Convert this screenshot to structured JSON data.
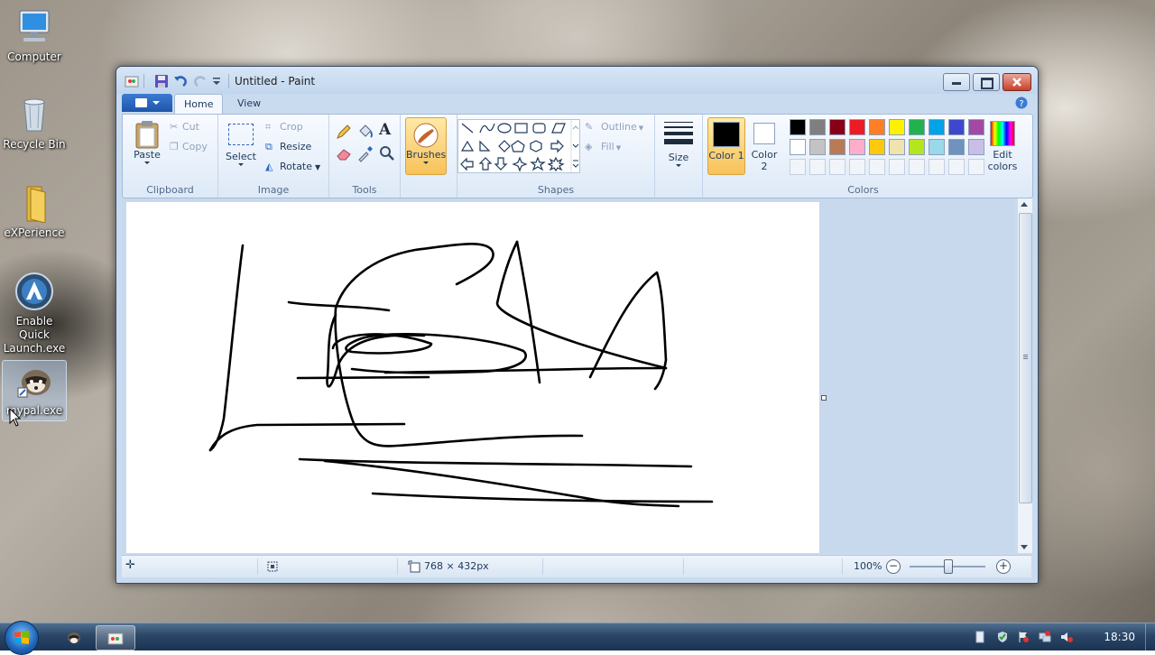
{
  "desktop": {
    "icons": [
      {
        "label": "Computer",
        "icon": "computer-icon"
      },
      {
        "label": "Recycle Bin",
        "icon": "recycle-bin-icon"
      },
      {
        "label": "eXPerience",
        "icon": "folder-icon"
      },
      {
        "label": "Enable Quick Launch.exe",
        "icon": "app-icon"
      },
      {
        "label": "mypal.exe",
        "icon": "raccoon-icon"
      }
    ]
  },
  "window": {
    "title": "Untitled - Paint",
    "tabs": [
      "Home",
      "View"
    ],
    "active_tab": "Home"
  },
  "ribbon": {
    "clipboard": {
      "label": "Clipboard",
      "paste": "Paste",
      "cut": "Cut",
      "copy": "Copy"
    },
    "image": {
      "label": "Image",
      "select": "Select",
      "crop": "Crop",
      "resize": "Resize",
      "rotate": "Rotate"
    },
    "tools": {
      "label": "Tools"
    },
    "brushes": {
      "label": "Brushes"
    },
    "shapes": {
      "label": "Shapes",
      "outline": "Outline",
      "fill": "Fill"
    },
    "size": {
      "label": "Size"
    },
    "colors": {
      "label": "Colors",
      "color1": "Color 1",
      "color1_value": "#000000",
      "color2": "Color 2",
      "color2_value": "#ffffff",
      "edit_colors": "Edit colors",
      "palette_row1": [
        "#000000",
        "#7f7f7f",
        "#880015",
        "#ed1c24",
        "#ff7f27",
        "#fff200",
        "#22b14c",
        "#00a2e8",
        "#3f48cc",
        "#a349a4"
      ],
      "palette_row2": [
        "#ffffff",
        "#c3c3c3",
        "#b97a57",
        "#ffaec9",
        "#ffc90e",
        "#efe4b0",
        "#b5e61d",
        "#99d9ea",
        "#7092be",
        "#c8bfe7"
      ]
    }
  },
  "status": {
    "canvas_size": "768 × 432px",
    "zoom": "100%"
  },
  "taskbar": {
    "clock": "18:30"
  }
}
